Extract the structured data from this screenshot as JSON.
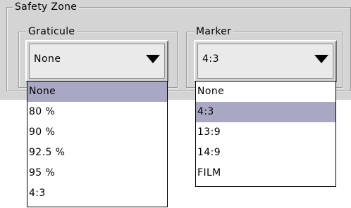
{
  "safety_zone": {
    "title": "Safety Zone"
  },
  "graticule": {
    "title": "Graticule",
    "selected_value": "None",
    "options": [
      "None",
      "80 %",
      "90 %",
      "92.5 %",
      "95 %",
      "4:3"
    ],
    "highlighted_option": "None"
  },
  "marker": {
    "title": "Marker",
    "selected_value": "4:3",
    "options": [
      "None",
      "4:3",
      "13:9",
      "14:9",
      "FILM"
    ],
    "highlighted_option": "4:3"
  },
  "colors": {
    "panel_background": "#d4d4d4",
    "list_highlight": "#a8a8c4",
    "list_background": "#ffffff"
  },
  "icons": {
    "dropdown_button": "chevron-down-icon"
  }
}
